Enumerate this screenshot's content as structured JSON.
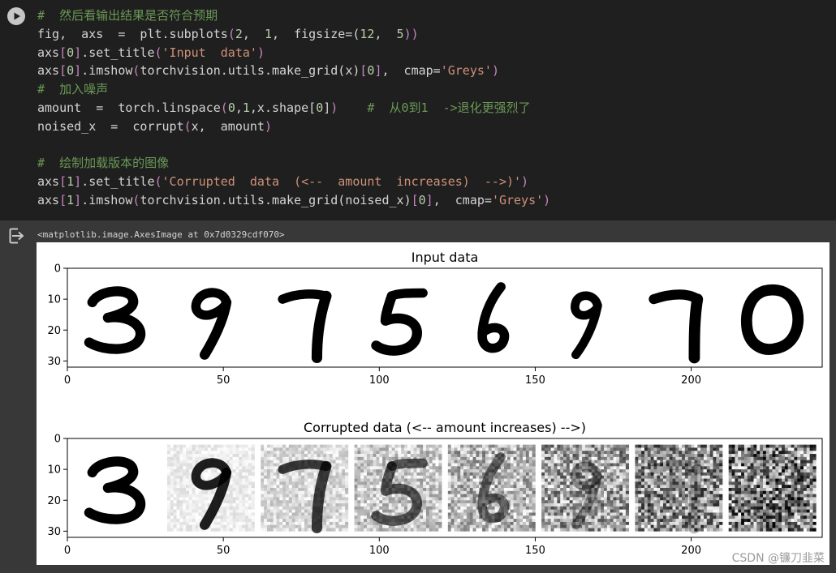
{
  "code_lines": [
    [
      {
        "t": "#  然后看输出结果是否符合预期",
        "c": "cm"
      }
    ],
    [
      {
        "t": "fig,  axs  =  plt.subplots"
      },
      {
        "t": "(",
        "c": "br2"
      },
      {
        "t": "2",
        "c": "num"
      },
      {
        "t": ",  "
      },
      {
        "t": "1",
        "c": "num"
      },
      {
        "t": ",  figsize="
      },
      {
        "t": "(",
        "c": "br"
      },
      {
        "t": "12",
        "c": "num"
      },
      {
        "t": ",  "
      },
      {
        "t": "5",
        "c": "num"
      },
      {
        "t": "))",
        "c": "br2"
      }
    ],
    [
      {
        "t": "axs"
      },
      {
        "t": "[",
        "c": "br2"
      },
      {
        "t": "0",
        "c": "num"
      },
      {
        "t": "]",
        "c": "br2"
      },
      {
        "t": ".set_title"
      },
      {
        "t": "(",
        "c": "br2"
      },
      {
        "t": "'Input  data'",
        "c": "str"
      },
      {
        "t": ")",
        "c": "br2"
      }
    ],
    [
      {
        "t": "axs"
      },
      {
        "t": "[",
        "c": "br2"
      },
      {
        "t": "0",
        "c": "num"
      },
      {
        "t": "]",
        "c": "br2"
      },
      {
        "t": ".imshow"
      },
      {
        "t": "(",
        "c": "br2"
      },
      {
        "t": "torchvision.utils.make_grid"
      },
      {
        "t": "(",
        "c": "br"
      },
      {
        "t": "x"
      },
      {
        "t": ")",
        "c": "br"
      },
      {
        "t": "[",
        "c": "br2"
      },
      {
        "t": "0",
        "c": "num"
      },
      {
        "t": "]",
        "c": "br2"
      },
      {
        "t": ",  cmap="
      },
      {
        "t": "'Greys'",
        "c": "str"
      },
      {
        "t": ")",
        "c": "br2"
      }
    ],
    [
      {
        "t": "#  加入噪声",
        "c": "cm"
      }
    ],
    [
      {
        "t": "amount  =  torch.linspace"
      },
      {
        "t": "(",
        "c": "br2"
      },
      {
        "t": "0",
        "c": "num"
      },
      {
        "t": ","
      },
      {
        "t": "1",
        "c": "num"
      },
      {
        "t": ",x.shape"
      },
      {
        "t": "[",
        "c": "br"
      },
      {
        "t": "0",
        "c": "num"
      },
      {
        "t": "]",
        "c": "br"
      },
      {
        "t": ")",
        "c": "br2"
      },
      {
        "t": "    "
      },
      {
        "t": "#  从0到1  ->退化更强烈了",
        "c": "cm"
      }
    ],
    [
      {
        "t": "noised_x  =  corrupt"
      },
      {
        "t": "(",
        "c": "br2"
      },
      {
        "t": "x,  amount"
      },
      {
        "t": ")",
        "c": "br2"
      }
    ],
    [
      {
        "t": ""
      }
    ],
    [
      {
        "t": "#  绘制加载版本的图像",
        "c": "cm"
      }
    ],
    [
      {
        "t": "axs"
      },
      {
        "t": "[",
        "c": "br2"
      },
      {
        "t": "1",
        "c": "num"
      },
      {
        "t": "]",
        "c": "br2"
      },
      {
        "t": ".set_title"
      },
      {
        "t": "(",
        "c": "br2"
      },
      {
        "t": "'Corrupted  data  (<--  amount  increases)  -->)'",
        "c": "str"
      },
      {
        "t": ")",
        "c": "br2"
      }
    ],
    [
      {
        "t": "axs"
      },
      {
        "t": "[",
        "c": "br2"
      },
      {
        "t": "1",
        "c": "num"
      },
      {
        "t": "]",
        "c": "br2"
      },
      {
        "t": ".imshow"
      },
      {
        "t": "(",
        "c": "br2"
      },
      {
        "t": "torchvision.utils.make_grid"
      },
      {
        "t": "(",
        "c": "br"
      },
      {
        "t": "noised_x"
      },
      {
        "t": ")",
        "c": "br"
      },
      {
        "t": "[",
        "c": "br2"
      },
      {
        "t": "0",
        "c": "num"
      },
      {
        "t": "]",
        "c": "br2"
      },
      {
        "t": ",  cmap="
      },
      {
        "t": "'Greys'",
        "c": "str"
      },
      {
        "t": ")",
        "c": "br2"
      }
    ]
  ],
  "output": {
    "repr_text": "<matplotlib.image.AxesImage at 0x7d0329cdf070>",
    "watermark": "CSDN @镰刀韭菜"
  },
  "icons": {
    "run": "play-icon",
    "output": "output-redirect-icon"
  },
  "colors": {
    "code_bg": "#1f1f1f",
    "output_bg": "#383838",
    "comment": "#6a9955",
    "string": "#ce9178",
    "number": "#b5cea8"
  },
  "chart_data": [
    {
      "type": "heatmap",
      "title": "Input data",
      "digits": [
        "3",
        "9",
        "7",
        "5",
        "6",
        "9",
        "7",
        "0"
      ],
      "noise_levels": [
        0,
        0,
        0,
        0,
        0,
        0,
        0,
        0
      ],
      "xlim": [
        0,
        242
      ],
      "ylim": [
        32,
        0
      ],
      "xticks": [
        0,
        50,
        100,
        150,
        200
      ],
      "yticks": [
        0,
        10,
        20,
        30
      ]
    },
    {
      "type": "heatmap",
      "title": "Corrupted data (<-- amount increases) -->)",
      "digits": [
        "3",
        "9",
        "7",
        "5",
        "6",
        "9",
        "7",
        "0"
      ],
      "noise_levels": [
        0.0,
        0.143,
        0.286,
        0.429,
        0.571,
        0.714,
        0.857,
        1.0
      ],
      "xlim": [
        0,
        242
      ],
      "ylim": [
        32,
        0
      ],
      "xticks": [
        0,
        50,
        100,
        150,
        200
      ],
      "yticks": [
        0,
        10,
        20,
        30
      ]
    }
  ]
}
